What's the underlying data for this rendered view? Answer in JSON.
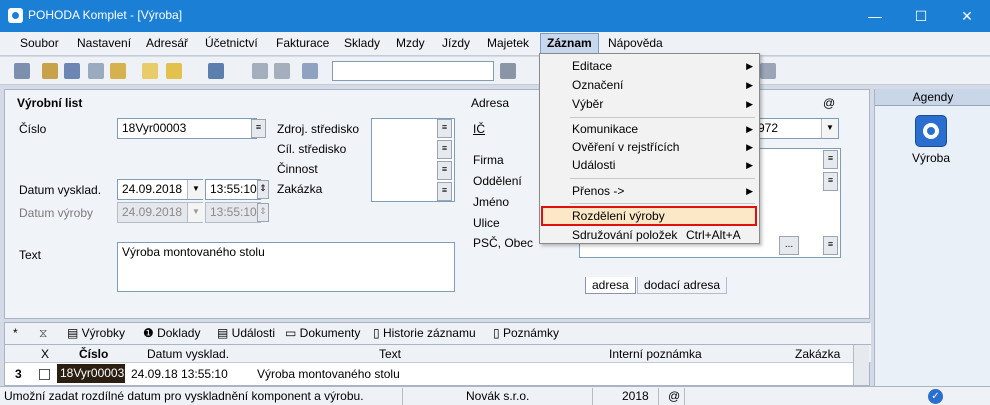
{
  "window": {
    "title": "POHODA Komplet - [Výroba]",
    "minimize": "—",
    "maximize": "☐",
    "close": "✕"
  },
  "menubar": [
    "Soubor",
    "Nastavení",
    "Adresář",
    "Účetnictví",
    "Fakturace",
    "Sklady",
    "Mzdy",
    "Jízdy",
    "Majetek",
    "Záznam",
    "Nápověda"
  ],
  "form": {
    "section_title": "Výrobní list",
    "cislo_label": "Číslo",
    "cislo_value": "18Vyr00003",
    "zdroj_label": "Zdroj. středisko",
    "cil_label": "Cíl. středisko",
    "cinnost_label": "Činnost",
    "zakazka_label": "Zakázka",
    "datum_vyskl_label": "Datum vysklad.",
    "datum_vyskl_value": "24.09.2018",
    "cas_vyskl_value": "13:55:10",
    "datum_vyroby_label": "Datum výroby",
    "datum_vyroby_value": "24.09.2018",
    "cas_vyroby_value": "13:55:10",
    "text_label": "Text",
    "text_value": "Výroba montovaného stolu",
    "adresa_label": "Adresa",
    "ic_label": "IČ",
    "ic_value": "972",
    "at_label": "@",
    "firma_label": "Firma",
    "oddeleni_label": "Oddělení",
    "jmeno_label": "Jméno",
    "ulice_label": "Ulice",
    "psc_label": "PSČ, Obec",
    "address_tab_1": "adresa",
    "address_tab_2": "dodací adresa"
  },
  "sidepanel": {
    "header": "Agendy",
    "item_label": "Výroba"
  },
  "grid": {
    "star": "*",
    "tabs": [
      "Výrobky",
      "Doklady",
      "Události",
      "Dokumenty",
      "Historie záznamu",
      "Poznámky"
    ],
    "columns": [
      "X",
      "Číslo",
      "Datum vysklad.",
      "Text",
      "Interní poznámka",
      "Zakázka"
    ],
    "row": {
      "index": "3",
      "cislo": "18Vyr00003",
      "datum": "24.09.18 13:55:10",
      "text": "Výroba montovaného stolu",
      "poznamka": "",
      "zakazka": ""
    }
  },
  "statusbar": {
    "message": "Umožní zadat rozdílné datum pro vyskladnění komponent a výrobu.",
    "company": "Novák s.r.o.",
    "year": "2018",
    "at": "@"
  },
  "dropdown_menu": {
    "items": [
      {
        "label": "Editace",
        "submenu": "▶"
      },
      {
        "label": "Označení",
        "submenu": "▶"
      },
      {
        "label": "Výběr",
        "submenu": "▶"
      },
      {
        "label": "Komunikace",
        "submenu": "▶"
      },
      {
        "label": "Ověření v rejstřících",
        "submenu": "▶"
      },
      {
        "label": "Události",
        "submenu": "▶"
      },
      {
        "label": "Přenos ->",
        "submenu": "▶"
      },
      {
        "label": "Rozdělení výroby",
        "shortcut": ""
      },
      {
        "label": "Sdružování položek",
        "shortcut": "Ctrl+Alt+A"
      }
    ]
  },
  "colors": {
    "titlebar": "#1c7fd6",
    "highlight_border": "#e01010",
    "highlight_fill": "#fce8c6",
    "selected_cell": "#2b1f12"
  }
}
